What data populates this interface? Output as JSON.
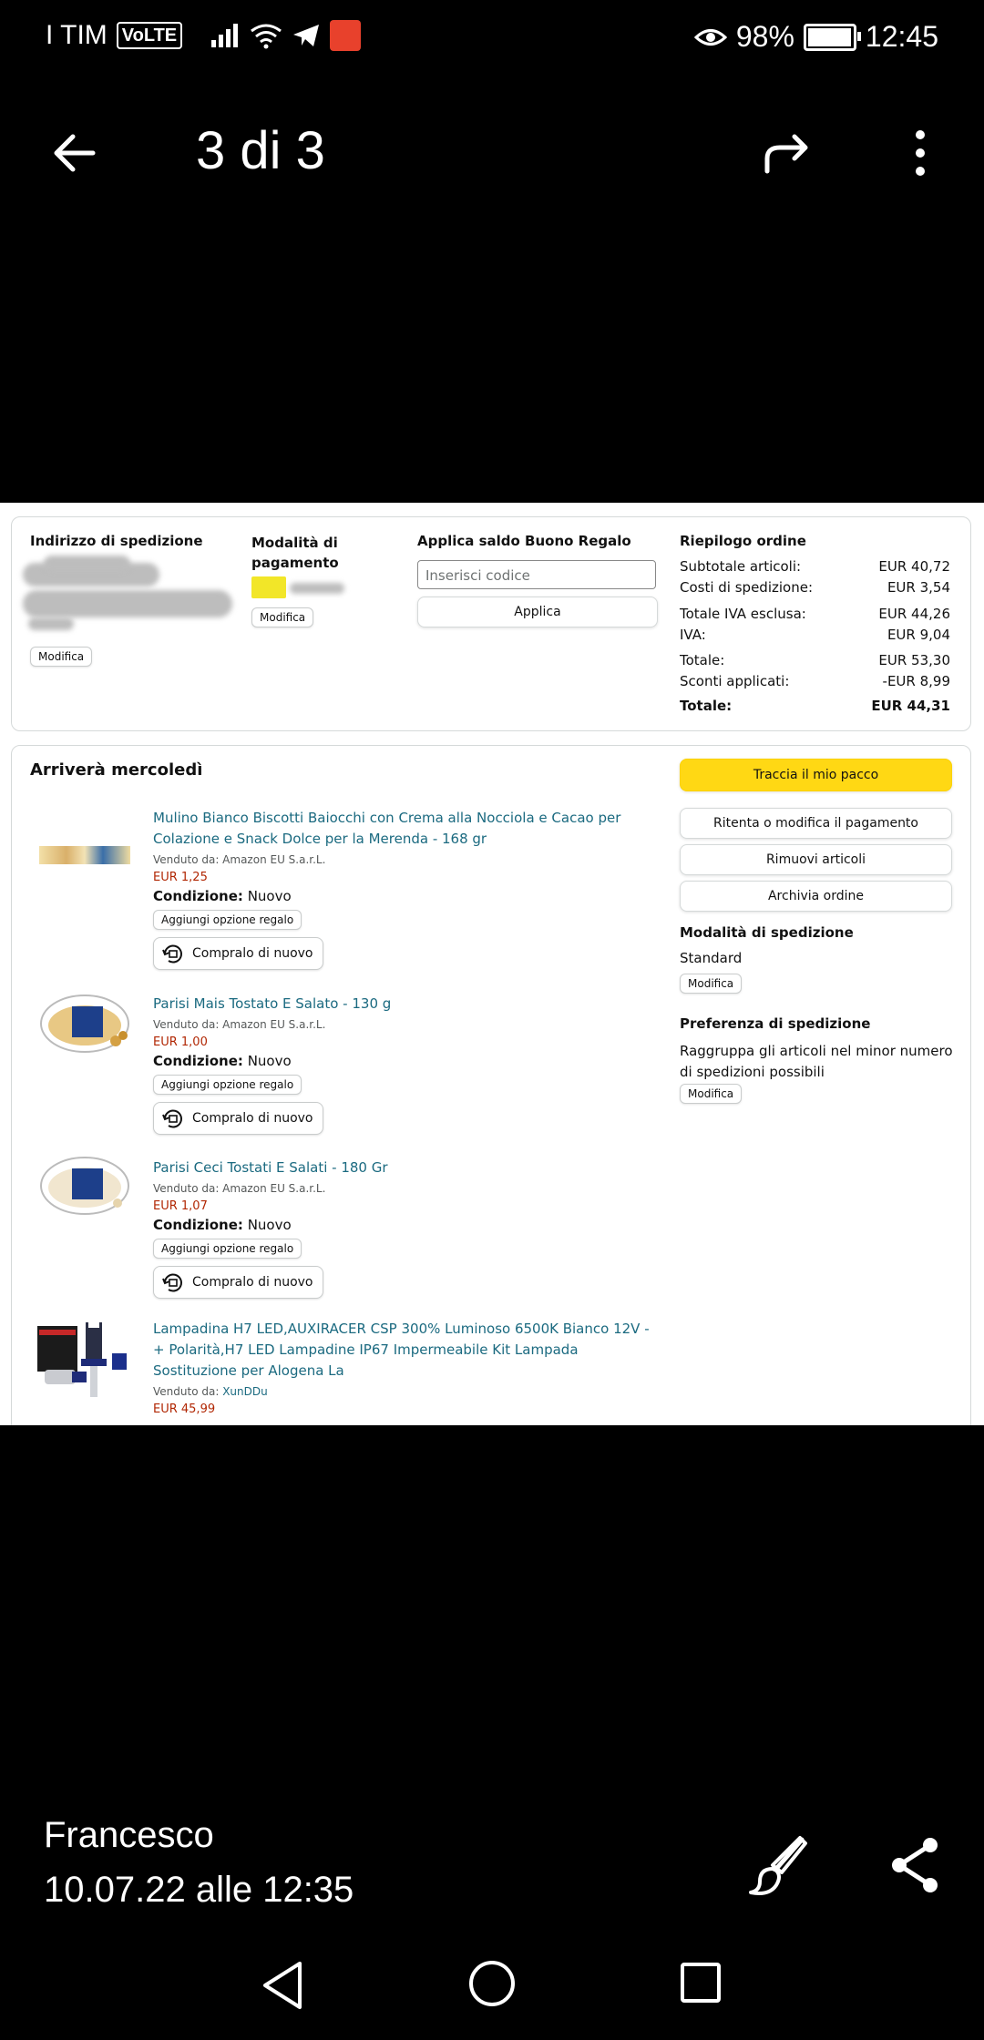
{
  "status": {
    "carrier": "I TIM",
    "volte": "VoLTE",
    "battery": "98%",
    "time": "12:45",
    "battery_level": 0.98
  },
  "viewer": {
    "counter": "3 di 3"
  },
  "order": {
    "shipping_address_label": "Indirizzo di spedizione",
    "payment_label": "Modalità di pagamento",
    "edit_label": "Modifica",
    "gift_label": "Applica saldo Buono Regalo",
    "gift_placeholder": "Inserisci codice",
    "apply_label": "Applica",
    "summary": {
      "title": "Riepilogo ordine",
      "rows": [
        {
          "label": "Subtotale articoli:",
          "value": "EUR 40,72"
        },
        {
          "label": "Costi di spedizione:",
          "value": "EUR 3,54"
        },
        {
          "label": "Totale IVA esclusa:",
          "value": "EUR 44,26"
        },
        {
          "label": "IVA:",
          "value": "EUR 9,04"
        },
        {
          "label": "Totale:",
          "value": "EUR 53,30"
        },
        {
          "label": "Sconti applicati:",
          "value": "-EUR 8,99"
        },
        {
          "label": "Totale:",
          "value": "EUR 44,31"
        }
      ]
    },
    "arrival": "Arriverà mercoledì",
    "actions": {
      "track": "Traccia il mio pacco",
      "retry_payment": "Ritenta o modifica il pagamento",
      "remove": "Rimuovi articoli",
      "archive": "Archivia ordine"
    },
    "shipping_mode_title": "Modalità di spedizione",
    "shipping_mode_value": "Standard",
    "shipping_pref_title": "Preferenza di spedizione",
    "shipping_pref_value": "Raggruppa gli articoli nel minor numero di spedizioni possibili",
    "gift_option": "Aggiungi opzione regalo",
    "buy_again": "Compralo di nuovo",
    "condition_label": "Condizione:",
    "items": [
      {
        "title": "Mulino Bianco Biscotti Baiocchi con Crema alla Nocciola e Cacao per Colazione e Snack Dolce per la Merenda - 168 gr",
        "seller": "Venduto da: Amazon EU S.a.r.L.",
        "price": "EUR 1,25",
        "condition": "Nuovo"
      },
      {
        "title": "Parisi Mais Tostato E Salato - 130 g",
        "seller": "Venduto da: Amazon EU S.a.r.L.",
        "price": "EUR 1,00",
        "condition": "Nuovo"
      },
      {
        "title": "Parisi Ceci Tostati E Salati - 180 Gr",
        "seller": "Venduto da: Amazon EU S.a.r.L.",
        "price": "EUR 1,07",
        "condition": "Nuovo"
      },
      {
        "title": "Lampadina H7 LED,AUXIRACER CSP 300% Luminoso 6500K Bianco 12V - + Polarità,H7 LED Lampadine IP67 Impermeabile Kit Lampada Sostituzione per Alogena La",
        "seller_prefix": "Venduto da: ",
        "seller_name": "XunDDu",
        "price": "EUR 45,99"
      }
    ]
  },
  "footer": {
    "sender": "Francesco",
    "date": "10.07.22 alle 12:35"
  }
}
